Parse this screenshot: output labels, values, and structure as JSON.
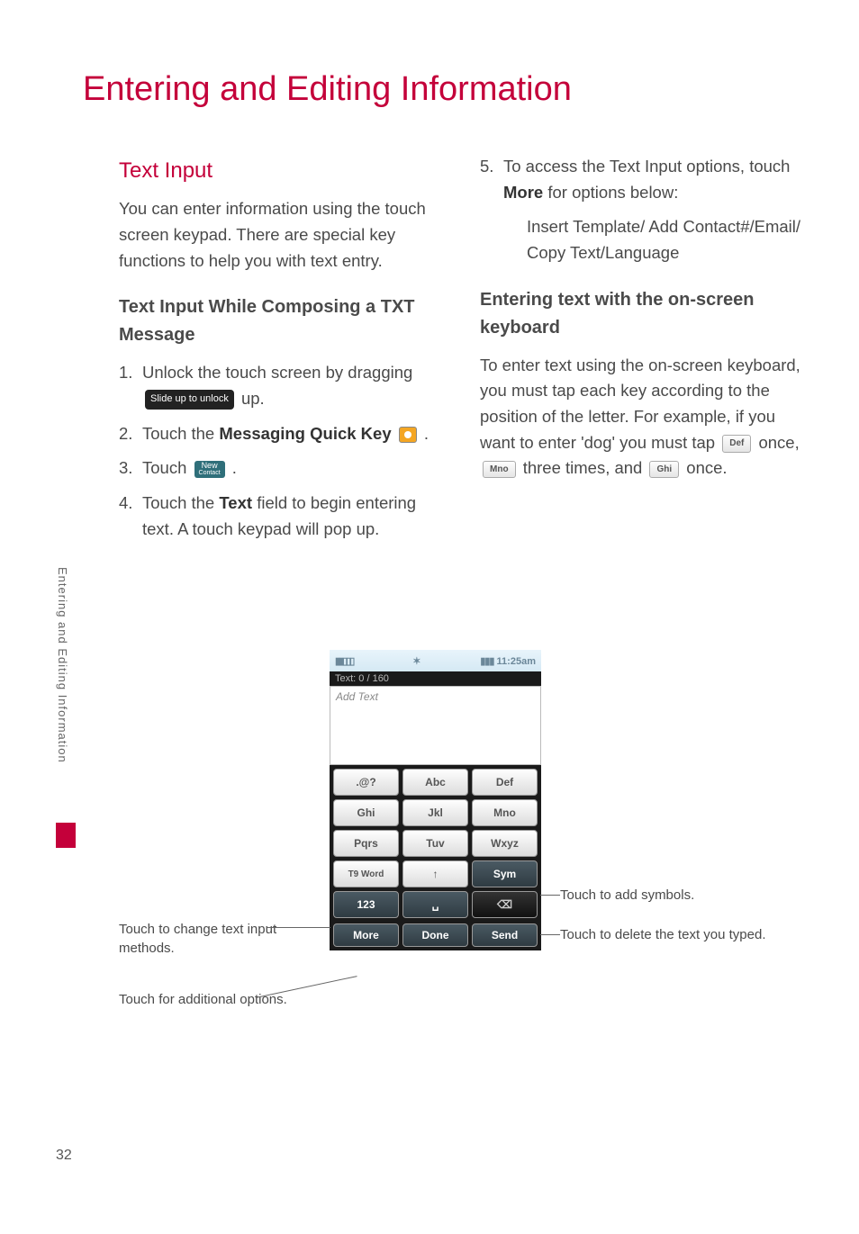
{
  "page_title": "Entering and Editing Information",
  "sidebar_text": "Entering and Editing Information",
  "page_number": "32",
  "left": {
    "heading": "Text Input",
    "intro": "You can enter information using the touch screen keypad. There are special key functions to help you with text entry.",
    "sub_heading": "Text Input While Composing a TXT Message",
    "steps": {
      "s1_a": "Unlock the touch screen by dragging ",
      "s1_chip": "Slide up to unlock",
      "s1_b": " up.",
      "s2_a": "Touch the ",
      "s2_bold": "Messaging Quick Key ",
      "s2_b": ".",
      "s3_a": "Touch ",
      "s3_chip_top": "New",
      "s3_chip_bottom": "Contact",
      "s3_b": ".",
      "s4_a": "Touch the ",
      "s4_bold": "Text",
      "s4_b": " field to begin entering text. A touch keypad will pop up."
    }
  },
  "right": {
    "s5_a": "To access the Text Input options, touch ",
    "s5_bold": "More",
    "s5_b": " for options below:",
    "s5_indent": "Insert Template/ Add Contact#/Email/ Copy Text/Language",
    "sub_heading": "Entering text with the on-screen keyboard",
    "p1_a": "To enter text using the on-screen keyboard, you must tap each key according to the position of the letter. For example, if you want to enter 'dog' you must tap ",
    "k_def": "Def",
    "p1_b": " once, ",
    "k_mno": "Mno",
    "p1_c": " three times, and ",
    "k_ghi": "Ghi",
    "p1_d": " once."
  },
  "phone": {
    "status_time": "11:25am",
    "counter": "Text: 0 / 160",
    "placeholder": "Add Text",
    "keys": [
      ".@?",
      "Abc",
      "Def",
      "Ghi",
      "Jkl",
      "Mno",
      "Pqrs",
      "Tuv",
      "Wxyz"
    ],
    "row4": [
      "T9 Word",
      "↑",
      "Sym"
    ],
    "row5": [
      "123",
      "␣",
      "⌫"
    ],
    "row6": [
      "More",
      "Done",
      "Send"
    ]
  },
  "annotations": {
    "left_mid": "Touch to change text input methods.",
    "left_bottom": "Touch for additional options.",
    "right_top": "Touch to add symbols.",
    "right_bottom": "Touch to delete the text you typed."
  }
}
